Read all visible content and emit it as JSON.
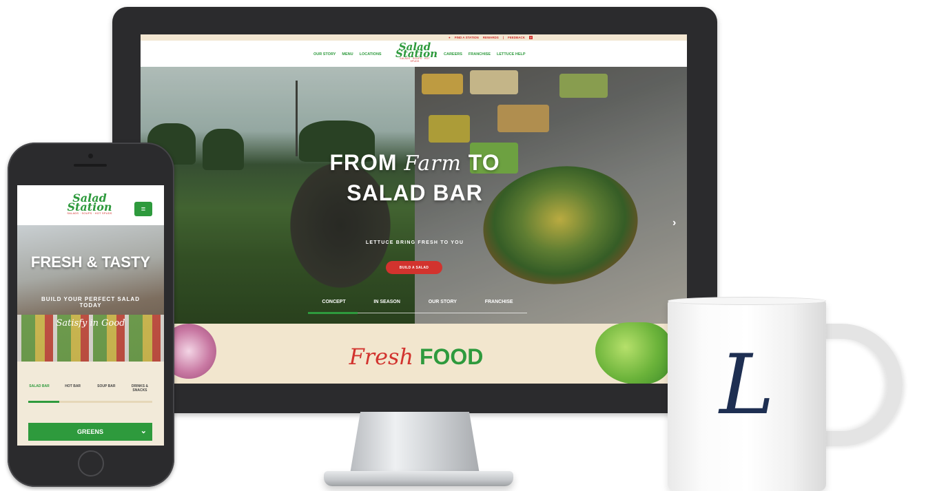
{
  "colors": {
    "brand_green": "#2e9a3d",
    "brand_red": "#d2332e",
    "mug_ink": "#1e2f52"
  },
  "desktop": {
    "topbar": {
      "find": "FIND A STATION",
      "rewards": "REWARDS",
      "sep": "|",
      "feedback": "FEEDBACK",
      "social_icon": "facebook-icon"
    },
    "nav": {
      "left": [
        "OUR STORY",
        "MENU",
        "LOCATIONS"
      ],
      "right": [
        "CAREERS",
        "FRANCHISE",
        "LETTUCE HELP"
      ]
    },
    "logo": {
      "line1": "Salad",
      "line2": "Station",
      "tagline": "SALADS · SOUPS · HOT SPUDS"
    },
    "hero": {
      "title_from": "FROM",
      "title_script": "Farm",
      "title_to": "TO",
      "title_line2": "SALAD BAR",
      "subtitle": "LETTUCE BRING FRESH TO YOU",
      "button": "BUILD A SALAD",
      "tabs": [
        "CONCEPT",
        "IN SEASON",
        "OUR STORY",
        "FRANCHISE"
      ]
    },
    "fresh": {
      "script": "Fresh",
      "word": "FOOD"
    }
  },
  "mobile": {
    "hero": {
      "title": "FRESH & TASTY",
      "subtitle": "BUILD YOUR PERFECT SALAD TODAY",
      "script": "Satisfy in Good"
    },
    "tabs": [
      "SALAD BAR",
      "HOT BAR",
      "SOUP BAR",
      "DRINKS & SNACKS"
    ],
    "tab_progress": 0.25,
    "select": {
      "value": "GREENS"
    }
  },
  "mug": {
    "letter": "L"
  }
}
